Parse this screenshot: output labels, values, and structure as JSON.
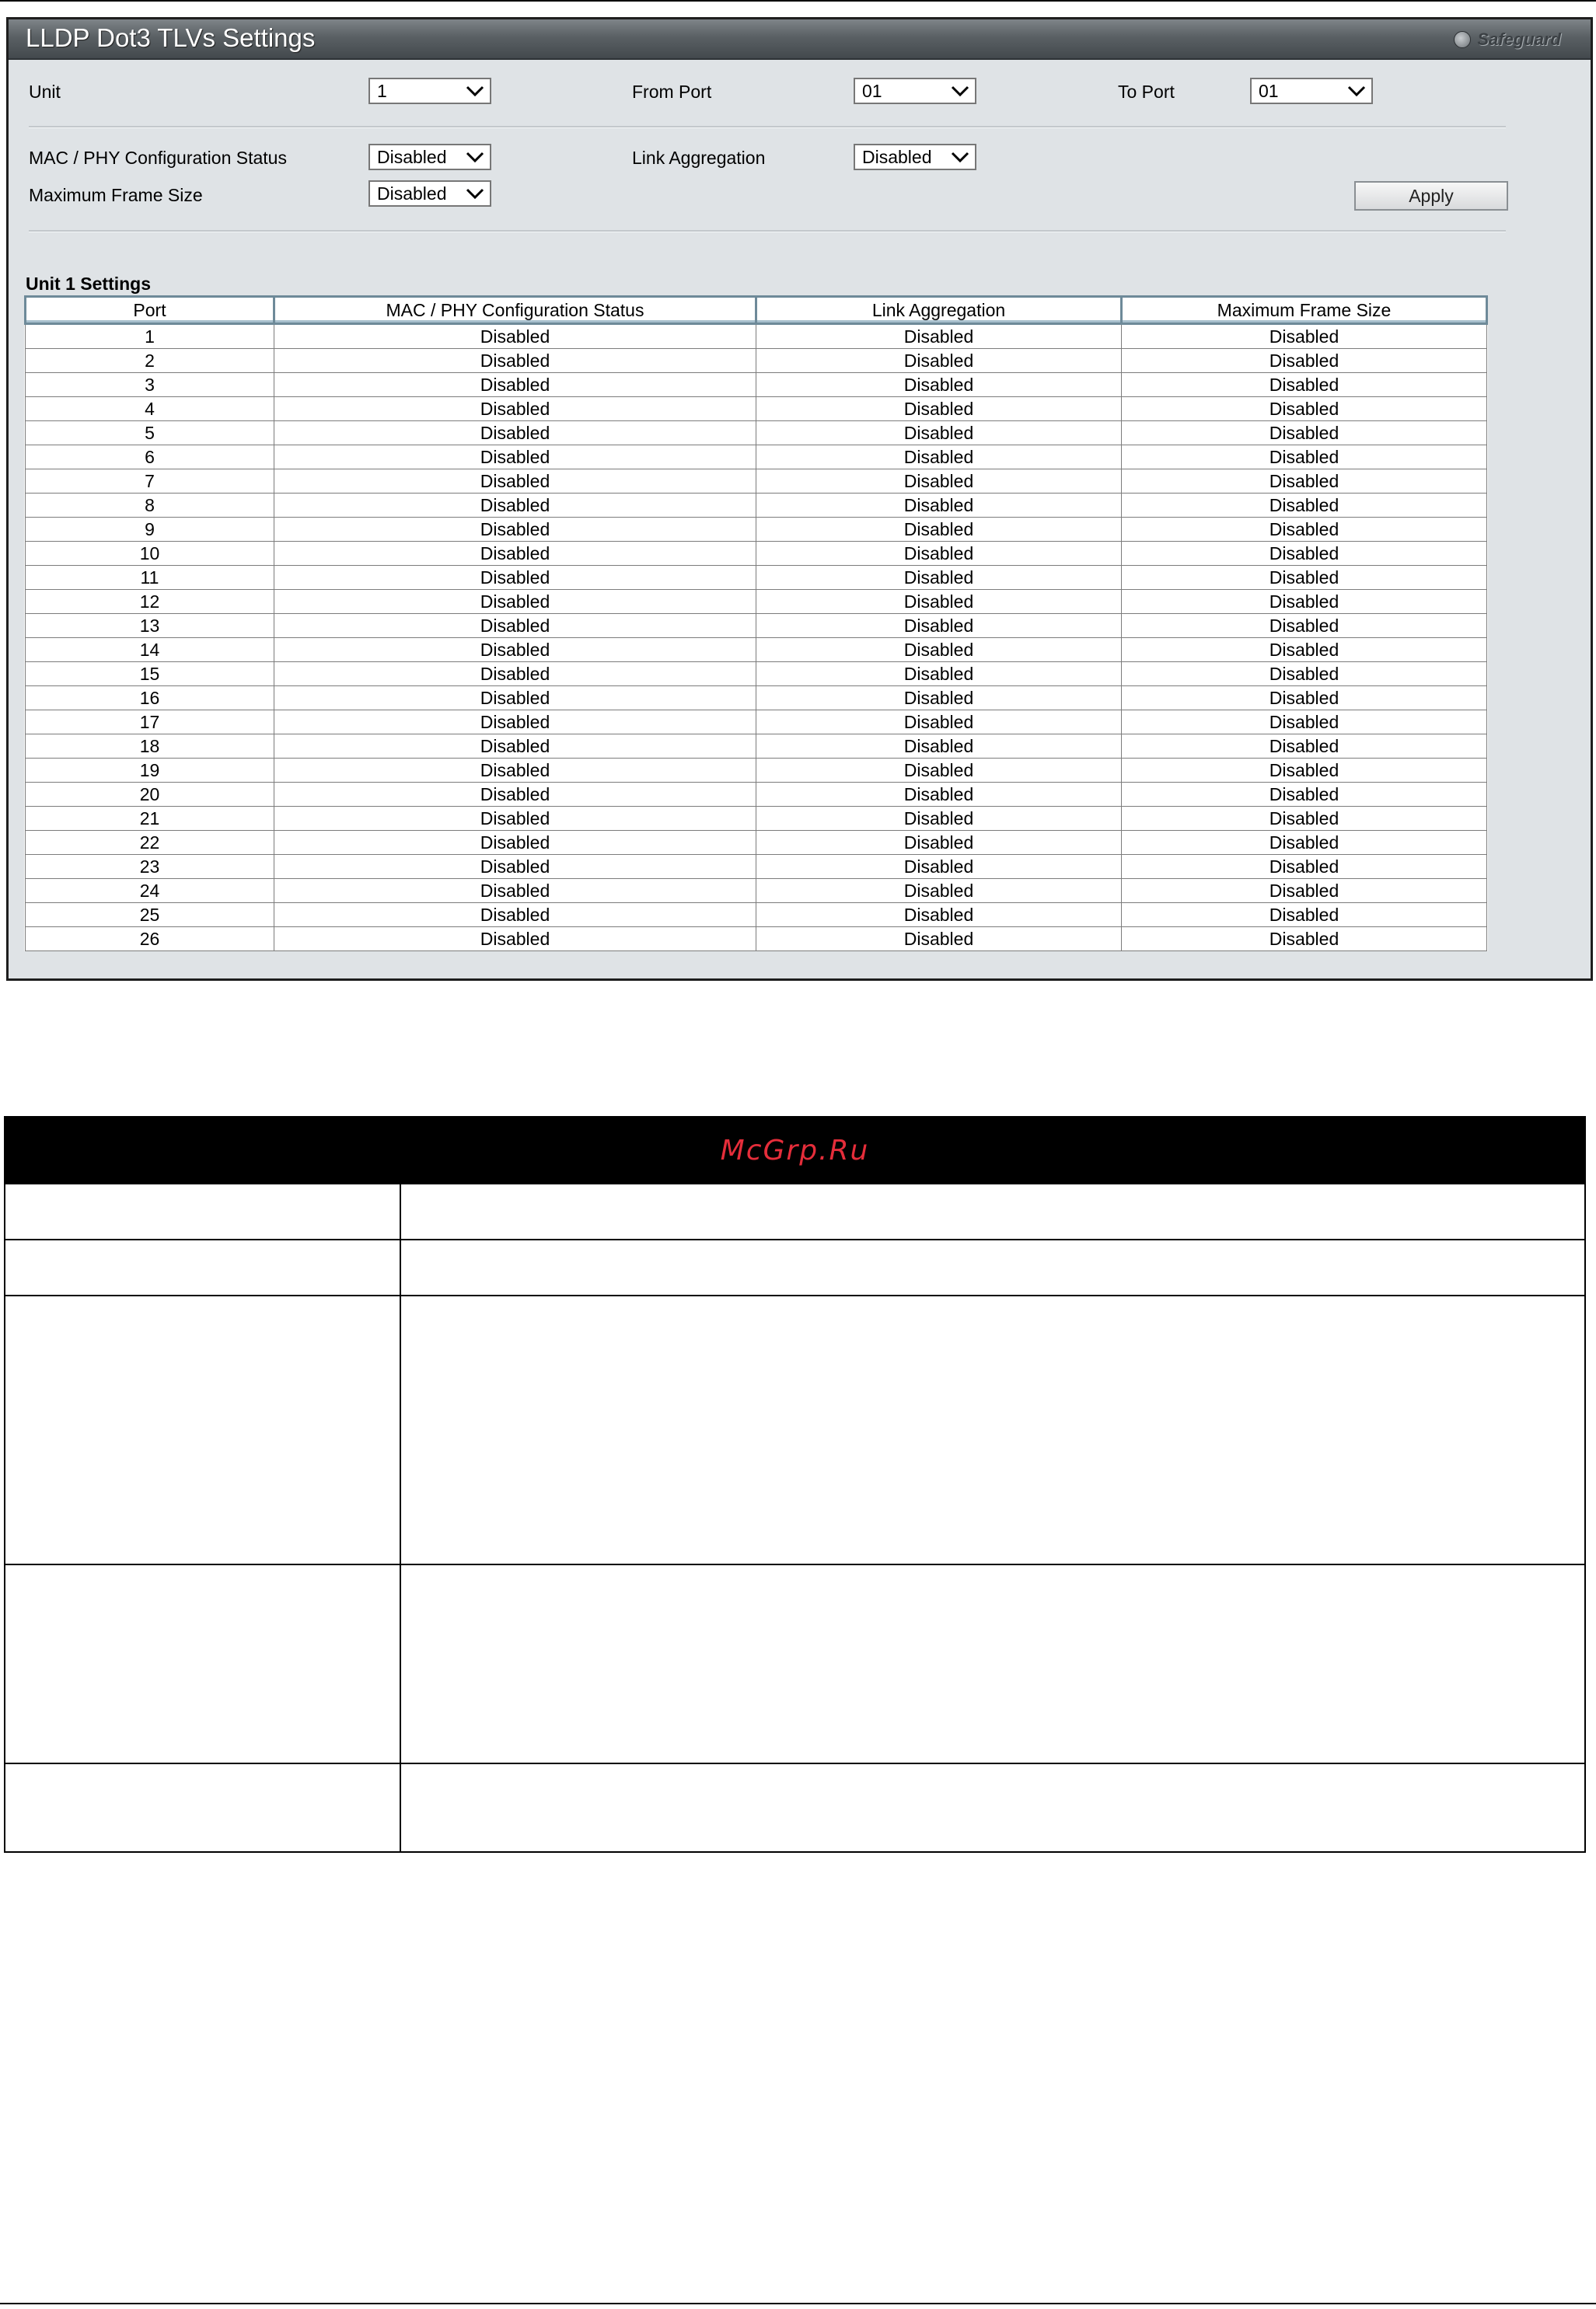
{
  "panel": {
    "title": "LLDP Dot3 TLVs Settings",
    "safeguard_label": "Safeguard"
  },
  "form": {
    "unit_label": "Unit",
    "unit_value": "1",
    "from_port_label": "From Port",
    "from_port_value": "01",
    "to_port_label": "To Port",
    "to_port_value": "01",
    "mac_phy_label": "MAC / PHY Configuration Status",
    "mac_phy_value": "Disabled",
    "link_agg_label": "Link Aggregation",
    "link_agg_value": "Disabled",
    "max_frame_label": "Maximum Frame Size",
    "max_frame_value": "Disabled",
    "apply_label": "Apply"
  },
  "table": {
    "section_title": "Unit 1 Settings",
    "headers": [
      "Port",
      "MAC / PHY Configuration Status",
      "Link Aggregation",
      "Maximum Frame Size"
    ],
    "rows": [
      [
        "1",
        "Disabled",
        "Disabled",
        "Disabled"
      ],
      [
        "2",
        "Disabled",
        "Disabled",
        "Disabled"
      ],
      [
        "3",
        "Disabled",
        "Disabled",
        "Disabled"
      ],
      [
        "4",
        "Disabled",
        "Disabled",
        "Disabled"
      ],
      [
        "5",
        "Disabled",
        "Disabled",
        "Disabled"
      ],
      [
        "6",
        "Disabled",
        "Disabled",
        "Disabled"
      ],
      [
        "7",
        "Disabled",
        "Disabled",
        "Disabled"
      ],
      [
        "8",
        "Disabled",
        "Disabled",
        "Disabled"
      ],
      [
        "9",
        "Disabled",
        "Disabled",
        "Disabled"
      ],
      [
        "10",
        "Disabled",
        "Disabled",
        "Disabled"
      ],
      [
        "11",
        "Disabled",
        "Disabled",
        "Disabled"
      ],
      [
        "12",
        "Disabled",
        "Disabled",
        "Disabled"
      ],
      [
        "13",
        "Disabled",
        "Disabled",
        "Disabled"
      ],
      [
        "14",
        "Disabled",
        "Disabled",
        "Disabled"
      ],
      [
        "15",
        "Disabled",
        "Disabled",
        "Disabled"
      ],
      [
        "16",
        "Disabled",
        "Disabled",
        "Disabled"
      ],
      [
        "17",
        "Disabled",
        "Disabled",
        "Disabled"
      ],
      [
        "18",
        "Disabled",
        "Disabled",
        "Disabled"
      ],
      [
        "19",
        "Disabled",
        "Disabled",
        "Disabled"
      ],
      [
        "20",
        "Disabled",
        "Disabled",
        "Disabled"
      ],
      [
        "21",
        "Disabled",
        "Disabled",
        "Disabled"
      ],
      [
        "22",
        "Disabled",
        "Disabled",
        "Disabled"
      ],
      [
        "23",
        "Disabled",
        "Disabled",
        "Disabled"
      ],
      [
        "24",
        "Disabled",
        "Disabled",
        "Disabled"
      ],
      [
        "25",
        "Disabled",
        "Disabled",
        "Disabled"
      ],
      [
        "26",
        "Disabled",
        "Disabled",
        "Disabled"
      ]
    ]
  },
  "doc": {
    "watermark": "McGrp.Ru"
  },
  "colors": {
    "title_bar": "#5a6064",
    "panel_bg": "#dfe3e6",
    "header_border": "#6e8a99",
    "watermark": "#e52d3a"
  },
  "icons": {
    "dropdown": "chevron-down-icon",
    "safeguard": "safeguard-indicator-icon"
  }
}
